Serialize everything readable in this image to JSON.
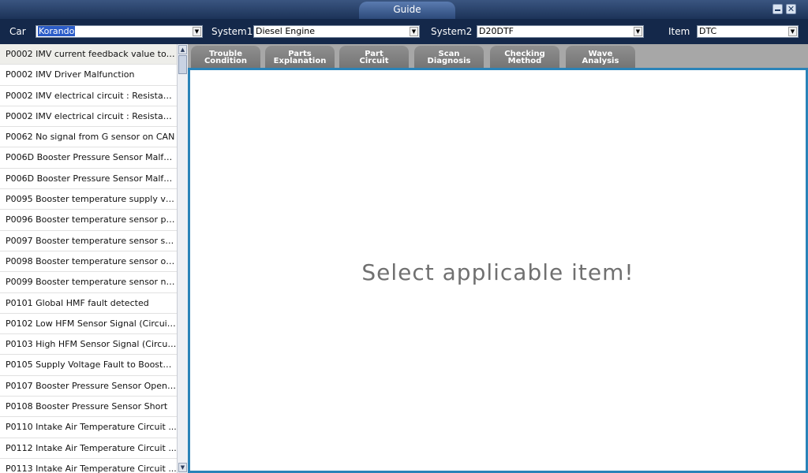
{
  "window": {
    "title": "Guide",
    "minimize_icon": "minimize-icon",
    "close_icon": "close-icon",
    "close_glyph": "✕"
  },
  "selectors": {
    "car": {
      "label": "Car",
      "value": "Korando"
    },
    "system1": {
      "label": "System1",
      "value": "Diesel Engine"
    },
    "system2": {
      "label": "System2",
      "value": "D20DTF"
    },
    "item": {
      "label": "Item",
      "value": "DTC"
    },
    "dropdown_arrow": "▼"
  },
  "dtc_list": [
    "P0002 IMV current feedback value to ...",
    "P0002 IMV Driver Malfunction",
    "P0002 IMV electrical circuit : Resistanc...",
    "P0002 IMV electrical circuit : Resistanc...",
    "P0062 No signal from G sensor on CAN",
    "P006D Booster Pressure Sensor Malfu...",
    "P006D Booster Pressure Sensor Malfu...",
    "P0095 Booster temperature supply vol...",
    "P0096 Booster temperature sensor pla...",
    "P0097 Booster temperature sensor sh...",
    "P0098 Booster temperature sensor op...",
    "P0099 Booster temperature sensor noi...",
    "P0101 Global HMF fault detected",
    "P0102 Low HFM Sensor Signal (Circuit ...",
    "P0103 High HFM Sensor Signal (Circuit ...",
    "P0105 Supply Voltage Fault to Booster...",
    "P0107 Booster Pressure Sensor Open/...",
    "P0108 Booster Pressure Sensor Short",
    "P0110 Intake Air Temperature Circuit ...",
    "P0112 Intake Air Temperature Circuit ...",
    "P0113 Intake Air Temperature Circuit ..."
  ],
  "scrollbar": {
    "up_arrow": "▲",
    "down_arrow": "▼"
  },
  "tabs": [
    {
      "line1": "Trouble",
      "line2": "Condition"
    },
    {
      "line1": "Parts",
      "line2": "Explanation"
    },
    {
      "line1": "Part",
      "line2": "Circuit"
    },
    {
      "line1": "Scan",
      "line2": "Diagnosis"
    },
    {
      "line1": "Checking",
      "line2": "Method"
    },
    {
      "line1": "Wave",
      "line2": "Analysis"
    }
  ],
  "content": {
    "message": "Select applicable item!"
  }
}
